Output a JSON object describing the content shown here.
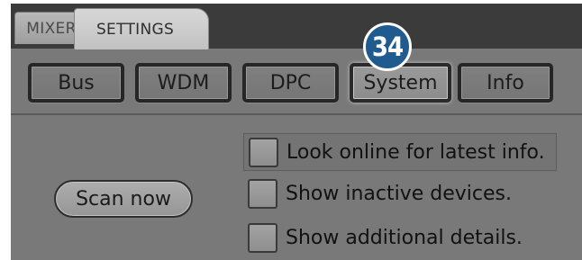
{
  "tabs": {
    "mixer": "MIXER",
    "settings": "SETTINGS"
  },
  "subtabs": {
    "bus": "Bus",
    "wdm": "WDM",
    "dpc": "DPC",
    "system": "System",
    "info": "Info"
  },
  "callout": "34",
  "scan_button": "Scan now",
  "options": {
    "online": "Look online for latest info.",
    "inactive": "Show inactive devices.",
    "details": "Show additional details."
  }
}
